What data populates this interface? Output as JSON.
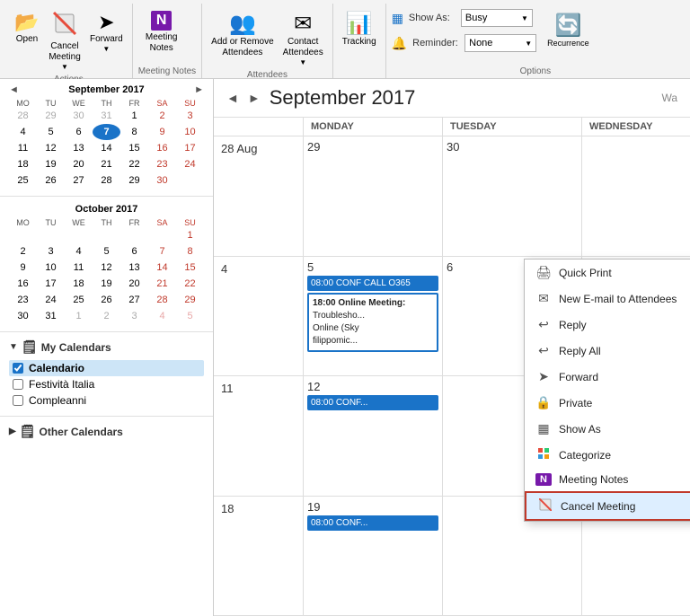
{
  "toolbar": {
    "groups": [
      {
        "name": "Actions",
        "label": "Actions",
        "buttons": [
          {
            "id": "open",
            "label": "Open",
            "icon": "📂"
          },
          {
            "id": "cancel-meeting",
            "label": "Cancel\nMeeting",
            "icon": "✖",
            "has_arrow": true
          },
          {
            "id": "forward",
            "label": "Forward",
            "icon": "➤",
            "has_arrow": true
          }
        ]
      },
      {
        "name": "Meeting Notes",
        "label": "Meeting Notes",
        "buttons": [
          {
            "id": "meeting-notes",
            "label": "Meeting\nNotes",
            "icon": "N"
          }
        ]
      },
      {
        "name": "Attendees",
        "label": "Attendees",
        "buttons": [
          {
            "id": "add-remove",
            "label": "Add or Remove\nAttendees",
            "icon": "👥"
          },
          {
            "id": "contact-attendees",
            "label": "Contact\nAttendees",
            "icon": "✉",
            "has_arrow": true
          }
        ]
      },
      {
        "name": "Tracking",
        "label": "",
        "buttons": [
          {
            "id": "tracking",
            "label": "Tracking",
            "icon": "📊"
          }
        ]
      },
      {
        "name": "Options",
        "label": "Options",
        "show_as_label": "Show As:",
        "show_as_value": "Busy",
        "reminder_label": "Reminder:",
        "reminder_value": "None",
        "recurrence_label": "Recurrence",
        "recurrence_icon": "🔄"
      }
    ]
  },
  "sidebar": {
    "sep2017": {
      "title": "September 2017",
      "days_header": [
        "MO",
        "TU",
        "WE",
        "TH",
        "FR",
        "SA",
        "SU"
      ],
      "weeks": [
        [
          {
            "n": "28",
            "cls": "other-month"
          },
          {
            "n": "29",
            "cls": "other-month"
          },
          {
            "n": "30",
            "cls": "other-month"
          },
          {
            "n": "31",
            "cls": "other-month"
          },
          {
            "n": "1",
            "cls": ""
          },
          {
            "n": "2",
            "cls": "weekend"
          },
          {
            "n": "3",
            "cls": "weekend"
          }
        ],
        [
          {
            "n": "4",
            "cls": ""
          },
          {
            "n": "5",
            "cls": ""
          },
          {
            "n": "6",
            "cls": ""
          },
          {
            "n": "7",
            "cls": "today"
          },
          {
            "n": "8",
            "cls": ""
          },
          {
            "n": "9",
            "cls": "weekend"
          },
          {
            "n": "10",
            "cls": "weekend"
          }
        ],
        [
          {
            "n": "11",
            "cls": ""
          },
          {
            "n": "12",
            "cls": ""
          },
          {
            "n": "13",
            "cls": ""
          },
          {
            "n": "14",
            "cls": ""
          },
          {
            "n": "15",
            "cls": ""
          },
          {
            "n": "16",
            "cls": "weekend"
          },
          {
            "n": "17",
            "cls": "weekend"
          }
        ],
        [
          {
            "n": "18",
            "cls": ""
          },
          {
            "n": "19",
            "cls": ""
          },
          {
            "n": "20",
            "cls": ""
          },
          {
            "n": "21",
            "cls": ""
          },
          {
            "n": "22",
            "cls": ""
          },
          {
            "n": "23",
            "cls": "weekend"
          },
          {
            "n": "24",
            "cls": "weekend"
          }
        ],
        [
          {
            "n": "25",
            "cls": ""
          },
          {
            "n": "26",
            "cls": ""
          },
          {
            "n": "27",
            "cls": ""
          },
          {
            "n": "28",
            "cls": ""
          },
          {
            "n": "29",
            "cls": ""
          },
          {
            "n": "30",
            "cls": "weekend"
          },
          {
            "n": "",
            "cls": ""
          }
        ]
      ]
    },
    "oct2017": {
      "title": "October 2017",
      "days_header": [
        "MO",
        "TU",
        "WE",
        "TH",
        "FR",
        "SA",
        "SU"
      ],
      "weeks": [
        [
          {
            "n": "",
            "cls": ""
          },
          {
            "n": "",
            "cls": ""
          },
          {
            "n": "",
            "cls": ""
          },
          {
            "n": "",
            "cls": ""
          },
          {
            "n": "",
            "cls": ""
          },
          {
            "n": "",
            "cls": ""
          },
          {
            "n": "1",
            "cls": "weekend"
          }
        ],
        [
          {
            "n": "2",
            "cls": ""
          },
          {
            "n": "3",
            "cls": ""
          },
          {
            "n": "4",
            "cls": ""
          },
          {
            "n": "5",
            "cls": ""
          },
          {
            "n": "6",
            "cls": ""
          },
          {
            "n": "7",
            "cls": "weekend"
          },
          {
            "n": "8",
            "cls": "weekend"
          }
        ],
        [
          {
            "n": "9",
            "cls": ""
          },
          {
            "n": "10",
            "cls": ""
          },
          {
            "n": "11",
            "cls": ""
          },
          {
            "n": "12",
            "cls": ""
          },
          {
            "n": "13",
            "cls": ""
          },
          {
            "n": "14",
            "cls": "weekend"
          },
          {
            "n": "15",
            "cls": "weekend"
          }
        ],
        [
          {
            "n": "16",
            "cls": ""
          },
          {
            "n": "17",
            "cls": ""
          },
          {
            "n": "18",
            "cls": ""
          },
          {
            "n": "19",
            "cls": ""
          },
          {
            "n": "20",
            "cls": ""
          },
          {
            "n": "21",
            "cls": "weekend"
          },
          {
            "n": "22",
            "cls": "weekend"
          }
        ],
        [
          {
            "n": "23",
            "cls": ""
          },
          {
            "n": "24",
            "cls": ""
          },
          {
            "n": "25",
            "cls": ""
          },
          {
            "n": "26",
            "cls": ""
          },
          {
            "n": "27",
            "cls": ""
          },
          {
            "n": "28",
            "cls": "weekend"
          },
          {
            "n": "29",
            "cls": "weekend"
          }
        ],
        [
          {
            "n": "30",
            "cls": ""
          },
          {
            "n": "31",
            "cls": ""
          },
          {
            "n": "1",
            "cls": "other-month"
          },
          {
            "n": "2",
            "cls": "other-month"
          },
          {
            "n": "3",
            "cls": "other-month"
          },
          {
            "n": "4",
            "cls": "other-month weekend"
          },
          {
            "n": "5",
            "cls": "other-month weekend"
          }
        ]
      ]
    },
    "my_calendars": {
      "title": "My Calendars",
      "items": [
        {
          "id": "calendario",
          "label": "Calendario",
          "checked": true,
          "selected": true
        },
        {
          "id": "festivita",
          "label": "Festività Italia",
          "checked": false
        },
        {
          "id": "compleanni",
          "label": "Compleanni",
          "checked": false
        }
      ]
    },
    "other_calendars": {
      "title": "Other Calendars",
      "items": []
    }
  },
  "calendar": {
    "nav_prev": "◄",
    "nav_next": "►",
    "title": "September 2017",
    "wa_label": "Wa",
    "columns": [
      "MONDAY",
      "TUESDAY",
      "WEDNESDAY"
    ],
    "weeks": [
      {
        "label": "28 Aug",
        "cells": [
          {
            "day": "29",
            "events": []
          },
          {
            "day": "30",
            "events": []
          }
        ]
      },
      {
        "label": "4",
        "cells": [
          {
            "day": "5",
            "events": [
              {
                "time": "08:00",
                "text": "CONF CALL O365",
                "type": "blue"
              },
              {
                "time": "18:00",
                "text": "Online Meeting: Troublesho... Online (Sky filippomic...",
                "type": "selected"
              }
            ]
          },
          {
            "day": "6",
            "events": []
          }
        ]
      },
      {
        "label": "11",
        "cells": [
          {
            "day": "12",
            "events": [
              {
                "time": "08:00",
                "text": "CONF...",
                "type": "blue"
              }
            ]
          },
          {
            "day": "",
            "events": []
          }
        ]
      },
      {
        "label": "18",
        "cells": [
          {
            "day": "19",
            "events": [
              {
                "time": "08:00",
                "text": "CONF...",
                "type": "blue"
              }
            ]
          },
          {
            "day": "",
            "events": []
          }
        ]
      }
    ]
  },
  "context_menu": {
    "items": [
      {
        "id": "quick-print",
        "icon": "🖨",
        "label": "Quick Print"
      },
      {
        "id": "new-email",
        "icon": "✉",
        "label": "New E-mail to Attendees"
      },
      {
        "id": "reply",
        "icon": "↩",
        "label": "Reply"
      },
      {
        "id": "reply-all",
        "icon": "↩↩",
        "label": "Reply All"
      },
      {
        "id": "forward",
        "icon": "➤",
        "label": "Forward"
      },
      {
        "id": "private",
        "icon": "🔒",
        "label": "Private"
      },
      {
        "id": "show-as",
        "icon": "▦",
        "label": "Show As",
        "has_sub": true
      },
      {
        "id": "categorize",
        "icon": "🗂",
        "label": "Categorize",
        "has_sub": true
      },
      {
        "id": "meeting-notes",
        "icon": "N",
        "label": "Meeting Notes",
        "is_onenote": true
      },
      {
        "id": "cancel-meeting",
        "icon": "🗓",
        "label": "Cancel Meeting",
        "is_cancel": true
      }
    ]
  }
}
